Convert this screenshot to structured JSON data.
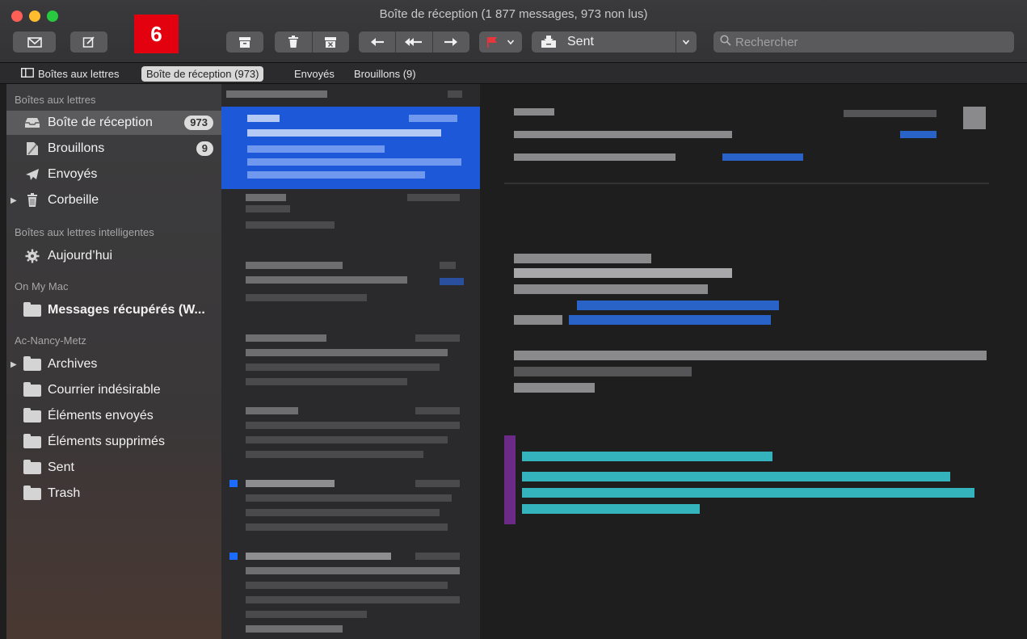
{
  "window": {
    "title": "Boîte de réception (1 877 messages, 973 non lus)"
  },
  "toolbar": {
    "get_mail_icon": "envelope-icon",
    "compose_icon": "compose-icon",
    "step_badge": "6",
    "archive_icon": "archive-icon",
    "delete_icon": "trash-icon",
    "junk_icon": "junk-icon",
    "reply_icon": "reply-icon",
    "reply_all_icon": "reply-all-icon",
    "forward_icon": "forward-icon",
    "flag_icon": "flag-icon",
    "flag_color": "#e8343b",
    "move_to_label": "Sent",
    "search_placeholder": "Rechercher"
  },
  "favorites_bar": {
    "mailboxes": "Boîtes aux lettres",
    "inbox": "Boîte de réception (973)",
    "sent": "Envoyés",
    "drafts": "Brouillons (9)"
  },
  "sidebar": {
    "section_mailboxes": "Boîtes aux lettres",
    "inbox": {
      "label": "Boîte de réception",
      "count": "973"
    },
    "drafts": {
      "label": "Brouillons",
      "count": "9"
    },
    "sent": {
      "label": "Envoyés"
    },
    "trash": {
      "label": "Corbeille"
    },
    "section_smart": "Boîtes aux lettres intelligentes",
    "today": {
      "label": "Aujourd’hui"
    },
    "section_on_my_mac": "On My Mac",
    "recovered": {
      "label": "Messages récupérés (W..."
    },
    "section_account": "Ac-Nancy-Metz",
    "account_items": [
      {
        "label": "Archives"
      },
      {
        "label": "Courrier indésirable"
      },
      {
        "label": "Éléments envoyés"
      },
      {
        "label": "Éléments supprimés"
      },
      {
        "label": "Sent"
      },
      {
        "label": "Trash"
      }
    ]
  },
  "colors": {
    "selection_blue": "#1d58d8",
    "unread_dot": "#1c6bff",
    "badge_red": "#e3000f"
  }
}
